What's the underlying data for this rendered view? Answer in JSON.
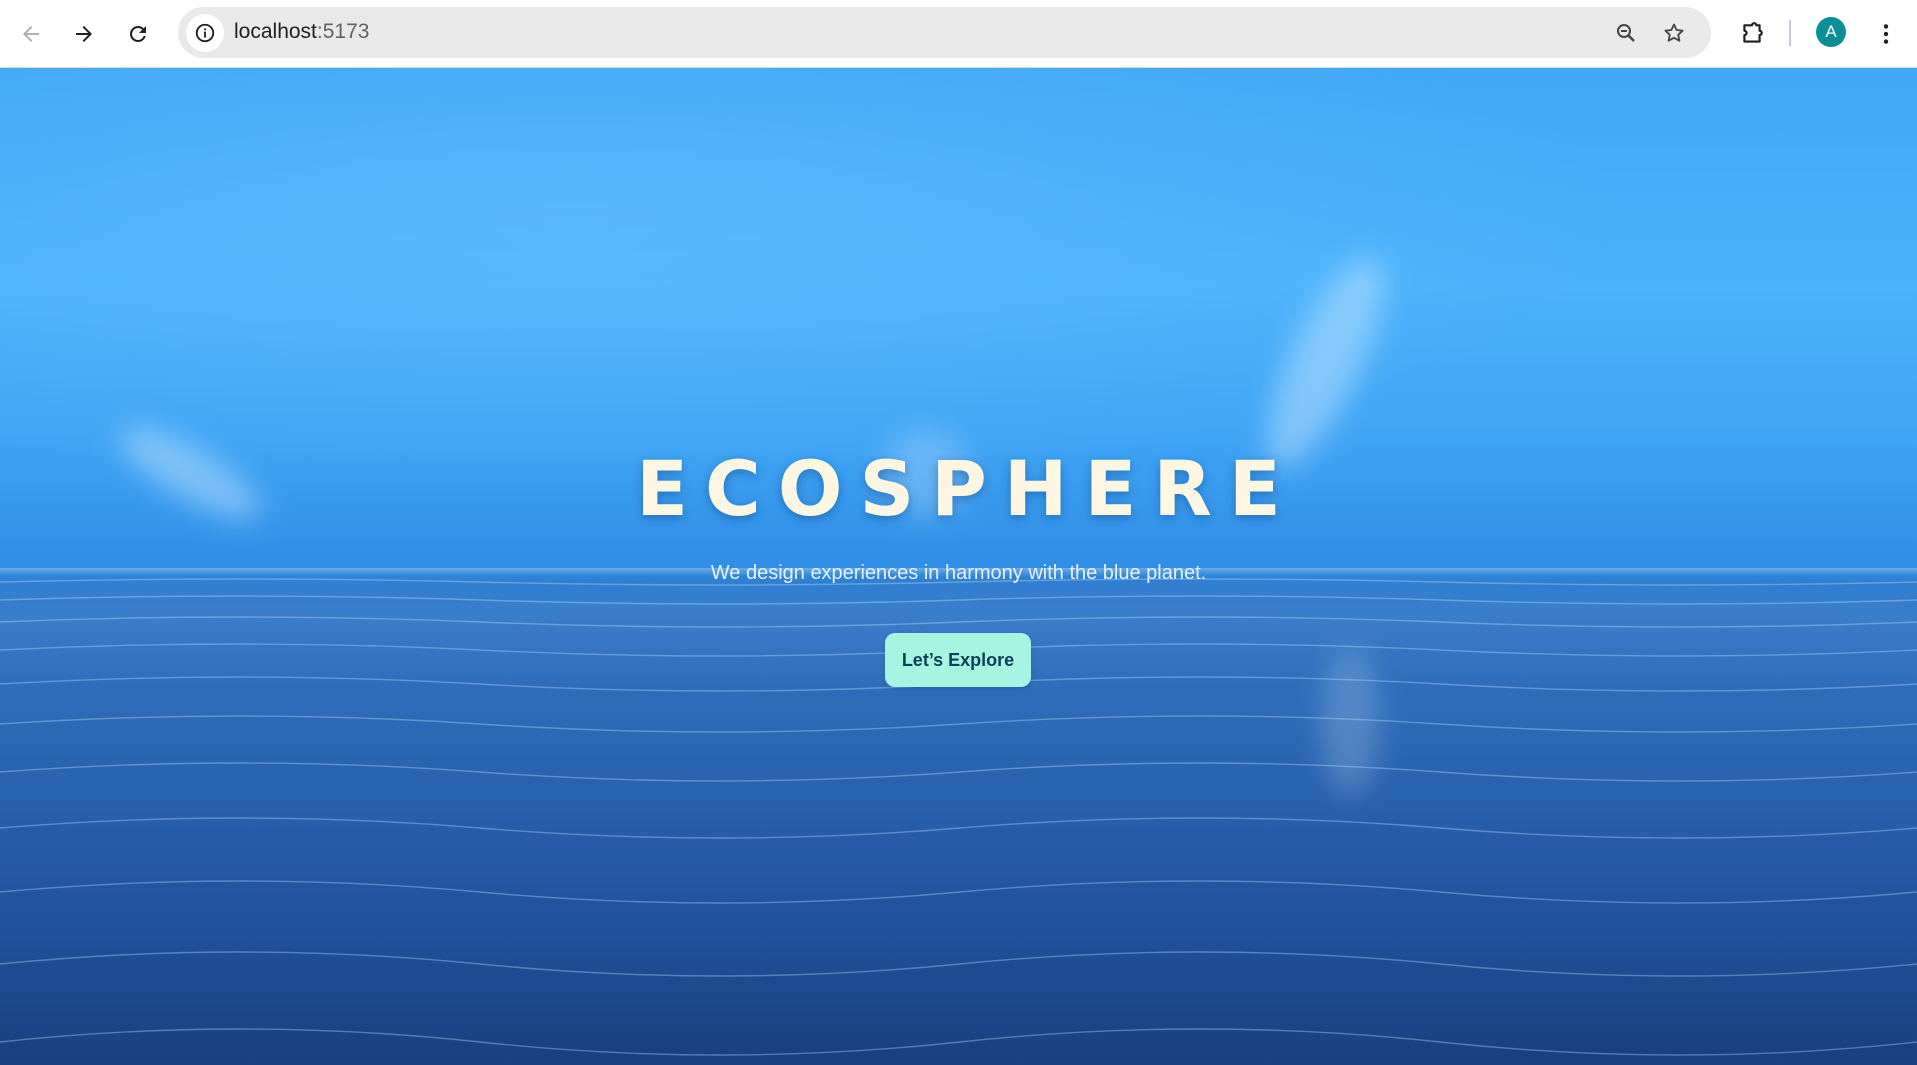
{
  "browser": {
    "url_host": "localhost",
    "url_port": ":5173",
    "profile_initial": "A",
    "colors": {
      "omnibox_bg": "#e9e9e9",
      "avatar_bg": "#0b8f96"
    },
    "icons": [
      "back-arrow-icon",
      "forward-arrow-icon",
      "reload-icon",
      "site-info-icon",
      "zoom-icon",
      "bookmark-star-icon",
      "extensions-icon",
      "more-menu-icon"
    ]
  },
  "hero": {
    "title": "ECOSPHERE",
    "tagline": "We design experiences in harmony with the blue planet.",
    "cta_label": "Let’s Explore",
    "colors": {
      "title": "#fdf6e3",
      "cta_bg": "#a6f5e3",
      "cta_text": "#0d3d5a",
      "sky": "#4bb2fb",
      "ocean_deep": "#19407f"
    }
  }
}
